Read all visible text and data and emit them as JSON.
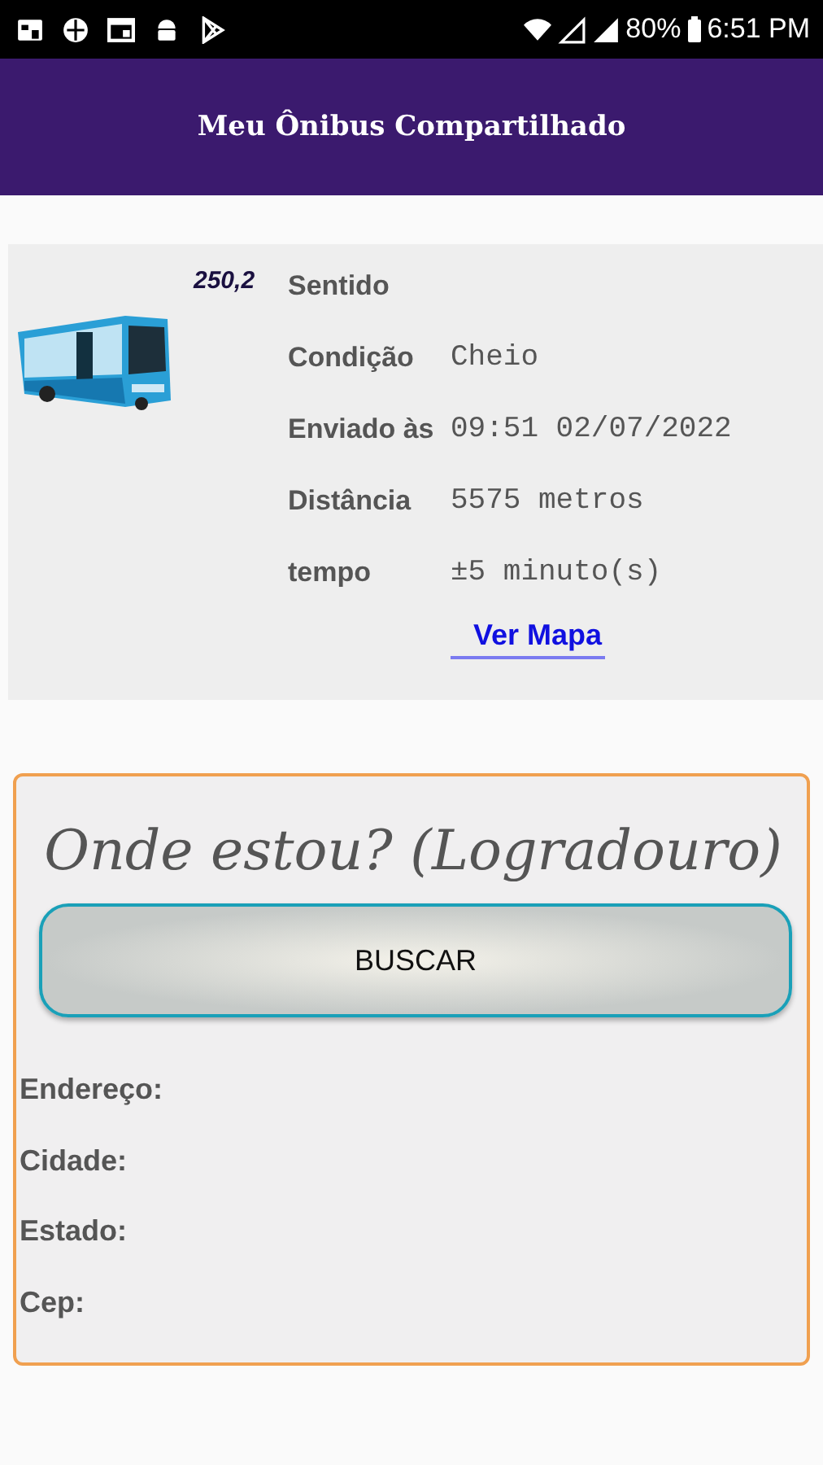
{
  "status_bar": {
    "battery": "80%",
    "time": "6:51 PM"
  },
  "app_bar": {
    "title": "Meu Ônibus Compartilhado"
  },
  "bus_card": {
    "route": "250,2",
    "fields": [
      {
        "label": "Sentido"
      },
      {
        "label": "Condição",
        "value": "Cheio"
      },
      {
        "label": "Enviado às",
        "value": "09:51 02/07/2022"
      },
      {
        "label": "Distância",
        "value": "5575 metros"
      },
      {
        "label": "tempo",
        "value": "±5 minuto(s)"
      }
    ],
    "link": "Ver Mapa"
  },
  "location_card": {
    "title": "Onde estou? (Logradouro)",
    "button": "BUSCAR",
    "fields": [
      {
        "label": "Endereço:"
      },
      {
        "label": "Cidade:"
      },
      {
        "label": "Estado:"
      },
      {
        "label": "Cep:"
      }
    ]
  }
}
